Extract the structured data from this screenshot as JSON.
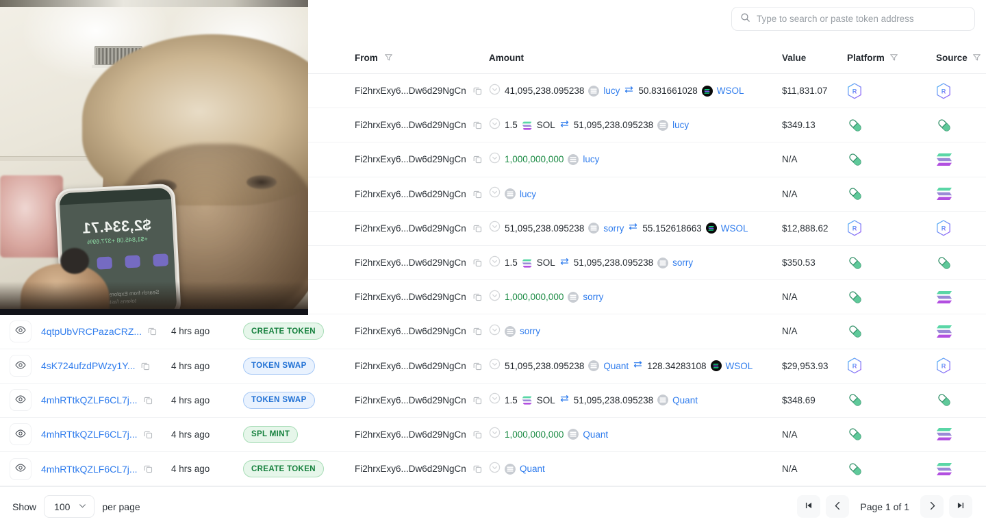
{
  "search": {
    "placeholder": "Type to search or paste token address",
    "value": "",
    "icon": "search-icon"
  },
  "table": {
    "columns": [
      {
        "key": "signature",
        "label": ""
      },
      {
        "key": "time",
        "label": ""
      },
      {
        "key": "type",
        "label": ""
      },
      {
        "key": "from",
        "label": "From",
        "filter": true
      },
      {
        "key": "amount",
        "label": "Amount",
        "filter": false
      },
      {
        "key": "value",
        "label": "Value",
        "filter": false
      },
      {
        "key": "platform",
        "label": "Platform",
        "filter": true
      },
      {
        "key": "source",
        "label": "Source",
        "filter": true
      }
    ],
    "rows": [
      {
        "signature": "",
        "time": "",
        "type": "",
        "from": "Fi2hrxExy6...Dw6d29NgCn",
        "amount": {
          "kind": "swap",
          "a_num": "41,095,238.095238",
          "a_tok": "lucy",
          "a_av": "generic",
          "b_num": "50.831661028",
          "b_tok": "WSOL",
          "b_av": "wsol"
        },
        "value": "$11,831.07",
        "platform": "raydium-icon",
        "source": "raydium-icon"
      },
      {
        "signature": "",
        "time": "",
        "type": "",
        "from": "Fi2hrxExy6...Dw6d29NgCn",
        "amount": {
          "kind": "swap",
          "a_num": "1.5",
          "a_tok": "SOL",
          "a_av": "sol",
          "a_plain": true,
          "b_num": "51,095,238.095238",
          "b_tok": "lucy",
          "b_av": "generic"
        },
        "value": "$349.13",
        "platform": "pumpfun-icon",
        "source": "pumpfun-icon"
      },
      {
        "signature": "",
        "time": "",
        "type": "",
        "from": "Fi2hrxExy6...Dw6d29NgCn",
        "amount": {
          "kind": "mint",
          "a_num": "1,000,000,000",
          "a_tok": "lucy",
          "a_av": "generic"
        },
        "value": "N/A",
        "platform": "pumpfun-icon",
        "source": "solana-icon"
      },
      {
        "signature": "",
        "time": "",
        "type": "",
        "from": "Fi2hrxExy6...Dw6d29NgCn",
        "amount": {
          "kind": "token",
          "a_num": "",
          "a_tok": "lucy",
          "a_av": "generic"
        },
        "value": "N/A",
        "platform": "pumpfun-icon",
        "source": "solana-icon"
      },
      {
        "signature": "",
        "time": "",
        "type": "",
        "from": "Fi2hrxExy6...Dw6d29NgCn",
        "amount": {
          "kind": "swap",
          "a_num": "51,095,238.095238",
          "a_tok": "sorry",
          "a_av": "generic",
          "b_num": "55.152618663",
          "b_tok": "WSOL",
          "b_av": "wsol"
        },
        "value": "$12,888.62",
        "platform": "raydium-icon",
        "source": "raydium-icon"
      },
      {
        "signature": "",
        "time": "",
        "type": "",
        "from": "Fi2hrxExy6...Dw6d29NgCn",
        "amount": {
          "kind": "swap",
          "a_num": "1.5",
          "a_tok": "SOL",
          "a_av": "sol",
          "a_plain": true,
          "b_num": "51,095,238.095238",
          "b_tok": "sorry",
          "b_av": "generic"
        },
        "value": "$350.53",
        "platform": "pumpfun-icon",
        "source": "pumpfun-icon"
      },
      {
        "signature": "",
        "time": "",
        "type": "",
        "from": "Fi2hrxExy6...Dw6d29NgCn",
        "amount": {
          "kind": "mint",
          "a_num": "1,000,000,000",
          "a_tok": "sorry",
          "a_av": "generic"
        },
        "value": "N/A",
        "platform": "pumpfun-icon",
        "source": "solana-icon"
      },
      {
        "signature": "4qtpUbVRCPazaCRZ...",
        "time": "4 hrs ago",
        "type": "CREATE TOKEN",
        "type_style": "create",
        "from": "Fi2hrxExy6...Dw6d29NgCn",
        "amount": {
          "kind": "token",
          "a_num": "",
          "a_tok": "sorry",
          "a_av": "generic"
        },
        "value": "N/A",
        "platform": "pumpfun-icon",
        "source": "solana-icon"
      },
      {
        "signature": "4sK724ufzdPWzy1Y...",
        "time": "4 hrs ago",
        "type": "TOKEN SWAP",
        "type_style": "swap",
        "from": "Fi2hrxExy6...Dw6d29NgCn",
        "amount": {
          "kind": "swap",
          "a_num": "51,095,238.095238",
          "a_tok": "Quant",
          "a_av": "generic",
          "b_num": "128.34283108",
          "b_tok": "WSOL",
          "b_av": "wsol"
        },
        "value": "$29,953.93",
        "platform": "raydium-icon",
        "source": "raydium-icon"
      },
      {
        "signature": "4mhRTtkQZLF6CL7j...",
        "time": "4 hrs ago",
        "type": "TOKEN SWAP",
        "type_style": "swap",
        "from": "Fi2hrxExy6...Dw6d29NgCn",
        "amount": {
          "kind": "swap",
          "a_num": "1.5",
          "a_tok": "SOL",
          "a_av": "sol",
          "a_plain": true,
          "b_num": "51,095,238.095238",
          "b_tok": "Quant",
          "b_av": "generic"
        },
        "value": "$348.69",
        "platform": "pumpfun-icon",
        "source": "pumpfun-icon"
      },
      {
        "signature": "4mhRTtkQZLF6CL7j...",
        "time": "4 hrs ago",
        "type": "SPL MINT",
        "type_style": "mint",
        "from": "Fi2hrxExy6...Dw6d29NgCn",
        "amount": {
          "kind": "mint",
          "a_num": "1,000,000,000",
          "a_tok": "Quant",
          "a_av": "generic"
        },
        "value": "N/A",
        "platform": "pumpfun-icon",
        "source": "solana-icon"
      },
      {
        "signature": "4mhRTtkQZLF6CL7j...",
        "time": "4 hrs ago",
        "type": "CREATE TOKEN",
        "type_style": "create",
        "from": "Fi2hrxExy6...Dw6d29NgCn",
        "amount": {
          "kind": "token",
          "a_num": "",
          "a_tok": "Quant",
          "a_av": "generic"
        },
        "value": "N/A",
        "platform": "pumpfun-icon",
        "source": "solana-icon"
      }
    ]
  },
  "footer": {
    "show_label": "Show",
    "per_page_value": "100",
    "per_page_label": "per page",
    "page_label": "Page 1 of 1",
    "first_icon": "first-page-icon",
    "prev_icon": "prev-page-icon",
    "next_icon": "next-page-icon",
    "last_icon": "last-page-icon"
  },
  "video": {
    "phone_balance": "$2,334.71",
    "phone_change": "+$1,845.08  +377.69%",
    "phone_hint": "Search from Explore to find new tokens faster"
  },
  "colors": {
    "link": "#2f7ced",
    "green_text": "#1a8a43",
    "badge_green_bg": "#e6f6ea",
    "badge_green_fg": "#15803d",
    "badge_blue_bg": "#e9f2fe",
    "badge_blue_fg": "#1d6fd4"
  }
}
